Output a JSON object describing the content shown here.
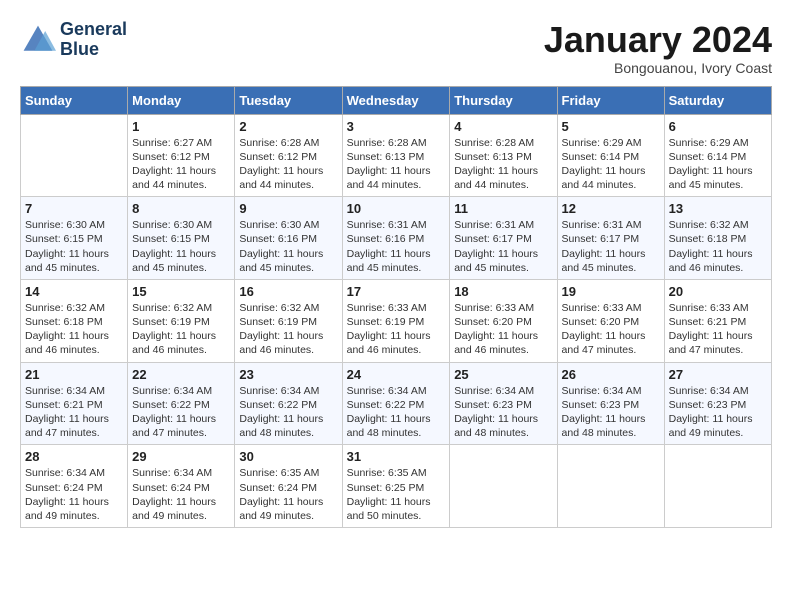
{
  "header": {
    "logo_line1": "General",
    "logo_line2": "Blue",
    "month": "January 2024",
    "location": "Bongouanou, Ivory Coast"
  },
  "days_of_week": [
    "Sunday",
    "Monday",
    "Tuesday",
    "Wednesday",
    "Thursday",
    "Friday",
    "Saturday"
  ],
  "weeks": [
    [
      {
        "day": "",
        "sunrise": "",
        "sunset": "",
        "daylight": ""
      },
      {
        "day": "1",
        "sunrise": "Sunrise: 6:27 AM",
        "sunset": "Sunset: 6:12 PM",
        "daylight": "Daylight: 11 hours and 44 minutes."
      },
      {
        "day": "2",
        "sunrise": "Sunrise: 6:28 AM",
        "sunset": "Sunset: 6:12 PM",
        "daylight": "Daylight: 11 hours and 44 minutes."
      },
      {
        "day": "3",
        "sunrise": "Sunrise: 6:28 AM",
        "sunset": "Sunset: 6:13 PM",
        "daylight": "Daylight: 11 hours and 44 minutes."
      },
      {
        "day": "4",
        "sunrise": "Sunrise: 6:28 AM",
        "sunset": "Sunset: 6:13 PM",
        "daylight": "Daylight: 11 hours and 44 minutes."
      },
      {
        "day": "5",
        "sunrise": "Sunrise: 6:29 AM",
        "sunset": "Sunset: 6:14 PM",
        "daylight": "Daylight: 11 hours and 44 minutes."
      },
      {
        "day": "6",
        "sunrise": "Sunrise: 6:29 AM",
        "sunset": "Sunset: 6:14 PM",
        "daylight": "Daylight: 11 hours and 45 minutes."
      }
    ],
    [
      {
        "day": "7",
        "sunrise": "Sunrise: 6:30 AM",
        "sunset": "Sunset: 6:15 PM",
        "daylight": "Daylight: 11 hours and 45 minutes."
      },
      {
        "day": "8",
        "sunrise": "Sunrise: 6:30 AM",
        "sunset": "Sunset: 6:15 PM",
        "daylight": "Daylight: 11 hours and 45 minutes."
      },
      {
        "day": "9",
        "sunrise": "Sunrise: 6:30 AM",
        "sunset": "Sunset: 6:16 PM",
        "daylight": "Daylight: 11 hours and 45 minutes."
      },
      {
        "day": "10",
        "sunrise": "Sunrise: 6:31 AM",
        "sunset": "Sunset: 6:16 PM",
        "daylight": "Daylight: 11 hours and 45 minutes."
      },
      {
        "day": "11",
        "sunrise": "Sunrise: 6:31 AM",
        "sunset": "Sunset: 6:17 PM",
        "daylight": "Daylight: 11 hours and 45 minutes."
      },
      {
        "day": "12",
        "sunrise": "Sunrise: 6:31 AM",
        "sunset": "Sunset: 6:17 PM",
        "daylight": "Daylight: 11 hours and 45 minutes."
      },
      {
        "day": "13",
        "sunrise": "Sunrise: 6:32 AM",
        "sunset": "Sunset: 6:18 PM",
        "daylight": "Daylight: 11 hours and 46 minutes."
      }
    ],
    [
      {
        "day": "14",
        "sunrise": "Sunrise: 6:32 AM",
        "sunset": "Sunset: 6:18 PM",
        "daylight": "Daylight: 11 hours and 46 minutes."
      },
      {
        "day": "15",
        "sunrise": "Sunrise: 6:32 AM",
        "sunset": "Sunset: 6:19 PM",
        "daylight": "Daylight: 11 hours and 46 minutes."
      },
      {
        "day": "16",
        "sunrise": "Sunrise: 6:32 AM",
        "sunset": "Sunset: 6:19 PM",
        "daylight": "Daylight: 11 hours and 46 minutes."
      },
      {
        "day": "17",
        "sunrise": "Sunrise: 6:33 AM",
        "sunset": "Sunset: 6:19 PM",
        "daylight": "Daylight: 11 hours and 46 minutes."
      },
      {
        "day": "18",
        "sunrise": "Sunrise: 6:33 AM",
        "sunset": "Sunset: 6:20 PM",
        "daylight": "Daylight: 11 hours and 46 minutes."
      },
      {
        "day": "19",
        "sunrise": "Sunrise: 6:33 AM",
        "sunset": "Sunset: 6:20 PM",
        "daylight": "Daylight: 11 hours and 47 minutes."
      },
      {
        "day": "20",
        "sunrise": "Sunrise: 6:33 AM",
        "sunset": "Sunset: 6:21 PM",
        "daylight": "Daylight: 11 hours and 47 minutes."
      }
    ],
    [
      {
        "day": "21",
        "sunrise": "Sunrise: 6:34 AM",
        "sunset": "Sunset: 6:21 PM",
        "daylight": "Daylight: 11 hours and 47 minutes."
      },
      {
        "day": "22",
        "sunrise": "Sunrise: 6:34 AM",
        "sunset": "Sunset: 6:22 PM",
        "daylight": "Daylight: 11 hours and 47 minutes."
      },
      {
        "day": "23",
        "sunrise": "Sunrise: 6:34 AM",
        "sunset": "Sunset: 6:22 PM",
        "daylight": "Daylight: 11 hours and 48 minutes."
      },
      {
        "day": "24",
        "sunrise": "Sunrise: 6:34 AM",
        "sunset": "Sunset: 6:22 PM",
        "daylight": "Daylight: 11 hours and 48 minutes."
      },
      {
        "day": "25",
        "sunrise": "Sunrise: 6:34 AM",
        "sunset": "Sunset: 6:23 PM",
        "daylight": "Daylight: 11 hours and 48 minutes."
      },
      {
        "day": "26",
        "sunrise": "Sunrise: 6:34 AM",
        "sunset": "Sunset: 6:23 PM",
        "daylight": "Daylight: 11 hours and 48 minutes."
      },
      {
        "day": "27",
        "sunrise": "Sunrise: 6:34 AM",
        "sunset": "Sunset: 6:23 PM",
        "daylight": "Daylight: 11 hours and 49 minutes."
      }
    ],
    [
      {
        "day": "28",
        "sunrise": "Sunrise: 6:34 AM",
        "sunset": "Sunset: 6:24 PM",
        "daylight": "Daylight: 11 hours and 49 minutes."
      },
      {
        "day": "29",
        "sunrise": "Sunrise: 6:34 AM",
        "sunset": "Sunset: 6:24 PM",
        "daylight": "Daylight: 11 hours and 49 minutes."
      },
      {
        "day": "30",
        "sunrise": "Sunrise: 6:35 AM",
        "sunset": "Sunset: 6:24 PM",
        "daylight": "Daylight: 11 hours and 49 minutes."
      },
      {
        "day": "31",
        "sunrise": "Sunrise: 6:35 AM",
        "sunset": "Sunset: 6:25 PM",
        "daylight": "Daylight: 11 hours and 50 minutes."
      },
      {
        "day": "",
        "sunrise": "",
        "sunset": "",
        "daylight": ""
      },
      {
        "day": "",
        "sunrise": "",
        "sunset": "",
        "daylight": ""
      },
      {
        "day": "",
        "sunrise": "",
        "sunset": "",
        "daylight": ""
      }
    ]
  ]
}
